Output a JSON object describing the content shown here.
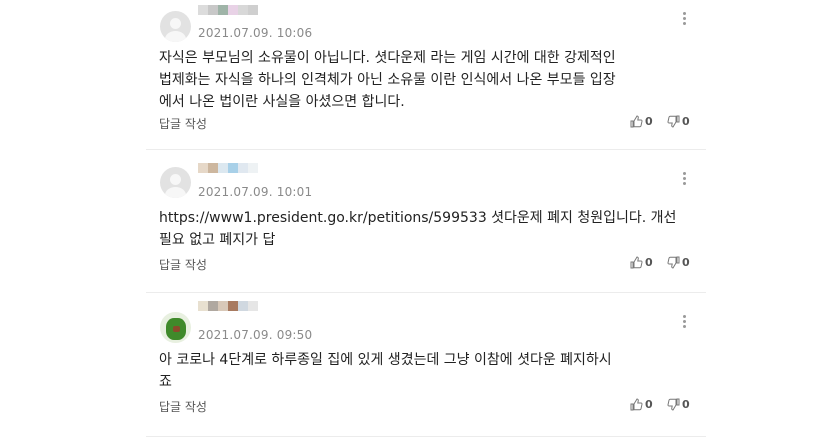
{
  "comments": [
    {
      "date": "2021.07.09. 10:06",
      "text_lines": [
        "자식은 부모님의 소유물이 아닙니다. 셧다운제 라는 게임 시간에 대한 강제적인",
        "법제화는 자식을 하나의 인격체가 아닌 소유물 이란 인식에서 나온 부모들 입장",
        "에서 나온 법이란 사실을 아셨으면 합니다."
      ],
      "reply_label": "답글 작성",
      "likes": "0",
      "dislikes": "0",
      "nick_colors": [
        "#dcdcdc",
        "#c8c8c8",
        "#9fb4a8",
        "#e8d2e6",
        "#d8d8d8",
        "#cfcfcf"
      ],
      "avatar_icon": "default-user-icon"
    },
    {
      "date": "2021.07.09. 10:01",
      "text_lines": [
        "https://www1.president.go.kr/petitions/599533 셧다운제 폐지 청원입니다. 개선",
        "필요 없고 폐지가 답"
      ],
      "reply_label": "답글 작성",
      "likes": "0",
      "dislikes": "0",
      "nick_colors": [
        "#e6d8c8",
        "#cdb79f",
        "#dce8f0",
        "#a8d0e8",
        "#e0e8f0",
        "#eef2f4"
      ],
      "avatar_icon": "default-user-icon"
    },
    {
      "date": "2021.07.09. 09:50",
      "text_lines": [
        "아 코로나 4단계로 하루종일 집에 있게 생겼는데 그냥 이참에 셧다운 폐지하시",
        "죠"
      ],
      "reply_label": "답글 작성",
      "likes": "0",
      "dislikes": "0",
      "nick_colors": [
        "#e8e0d0",
        "#b0a8a0",
        "#d8c8b8",
        "#a87a60",
        "#d0d8e0",
        "#e6e6e6"
      ],
      "avatar_icon": "profile-photo-icon"
    }
  ],
  "icons": {
    "more": "more-vertical-icon",
    "like": "thumbs-up-icon",
    "dislike": "thumbs-down-icon"
  }
}
